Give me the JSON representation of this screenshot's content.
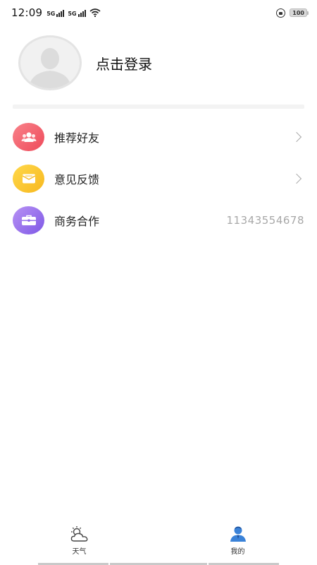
{
  "status_bar": {
    "time": "12:09",
    "signal1_label": "5G",
    "signal2_label": "5G",
    "battery": "100"
  },
  "profile": {
    "login_text": "点击登录"
  },
  "menu": {
    "items": [
      {
        "label": "推荐好友",
        "icon": "friends-icon",
        "color": "#f0606c"
      },
      {
        "label": "意见反馈",
        "icon": "feedback-icon",
        "color": "#f9c42f"
      },
      {
        "label": "商务合作",
        "icon": "briefcase-icon",
        "color": "#9670ec",
        "value": "11343554678"
      }
    ]
  },
  "tabbar": {
    "tabs": [
      {
        "label": "天气",
        "icon": "weather-icon",
        "active": false
      },
      {
        "label": "我的",
        "icon": "profile-icon",
        "active": true
      }
    ],
    "active_color": "#3a82d8"
  }
}
